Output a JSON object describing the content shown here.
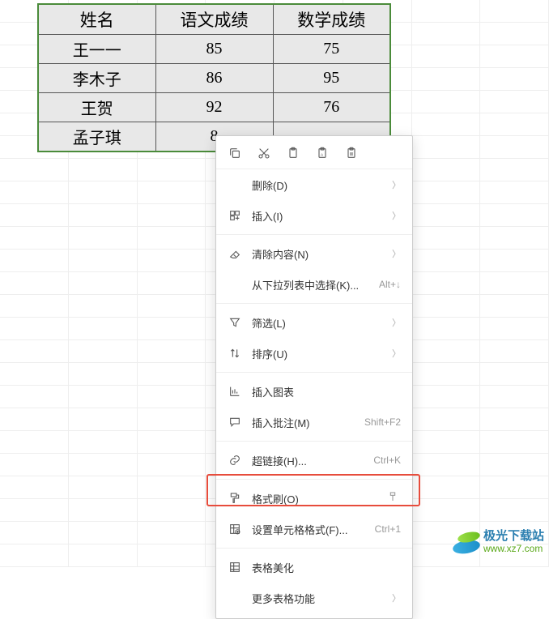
{
  "chart_data": {
    "type": "table",
    "columns": [
      "姓名",
      "语文成绩",
      "数学成绩"
    ],
    "rows": [
      [
        "王一一",
        85,
        75
      ],
      [
        "李木子",
        86,
        95
      ],
      [
        "王贺",
        92,
        76
      ],
      [
        "孟子琪",
        8,
        null
      ]
    ]
  },
  "table": {
    "headers": {
      "c1": "姓名",
      "c2": "语文成绩",
      "c3": "数学成绩"
    },
    "rows": [
      {
        "c1": "王一一",
        "c2": "85",
        "c3": "75"
      },
      {
        "c1": "李木子",
        "c2": "86",
        "c3": "95"
      },
      {
        "c1": "王贺",
        "c2": "92",
        "c3": "76"
      },
      {
        "c1": "孟子琪",
        "c2": "8",
        "c3": ""
      }
    ]
  },
  "menu": {
    "delete": {
      "label": "删除(D)"
    },
    "insert": {
      "label": "插入(I)"
    },
    "clear": {
      "label": "清除内容(N)"
    },
    "dropdown": {
      "label": "从下拉列表中选择(K)...",
      "shortcut": "Alt+↓"
    },
    "filter": {
      "label": "筛选(L)"
    },
    "sort": {
      "label": "排序(U)"
    },
    "chart": {
      "label": "插入图表"
    },
    "comment": {
      "label": "插入批注(M)",
      "shortcut": "Shift+F2"
    },
    "hyperlink": {
      "label": "超链接(H)...",
      "shortcut": "Ctrl+K"
    },
    "formatpaint": {
      "label": "格式刷(O)"
    },
    "cellformat": {
      "label": "设置单元格格式(F)...",
      "shortcut": "Ctrl+1"
    },
    "beautify": {
      "label": "表格美化"
    },
    "more": {
      "label": "更多表格功能"
    }
  },
  "watermark": {
    "name": "极光下载站",
    "url": "www.xz7.com"
  }
}
